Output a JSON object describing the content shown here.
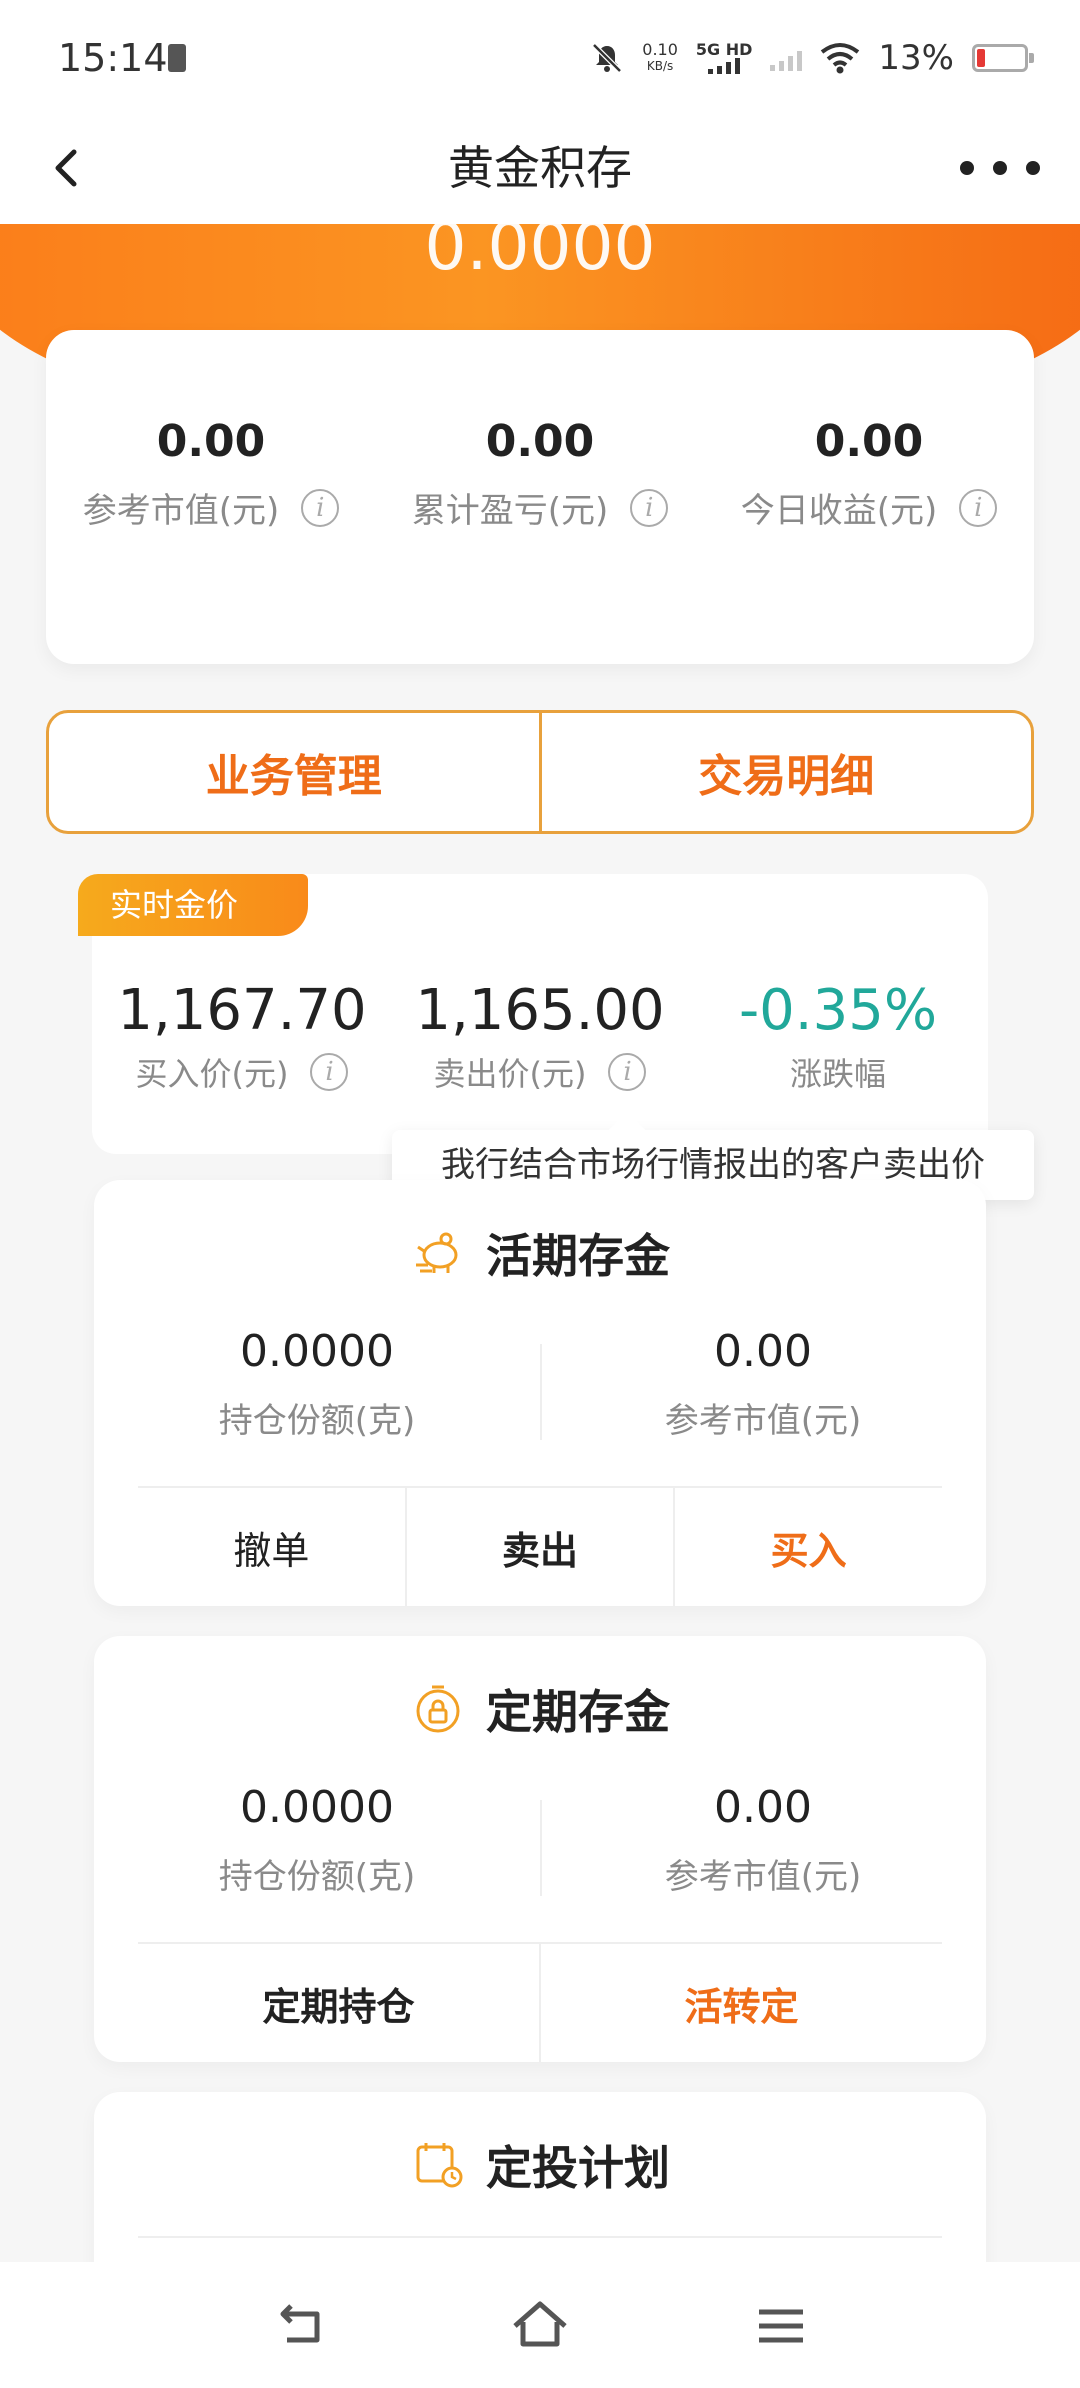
{
  "status_bar": {
    "time": "15:14",
    "net_speed_value": "0.10",
    "net_speed_unit": "KB/s",
    "network_type": "5G HD",
    "battery_percent": "13%"
  },
  "header": {
    "title": "黄金积存"
  },
  "banner": {
    "total_value": "0.0000"
  },
  "summary": {
    "items": [
      {
        "value": "0.00",
        "label": "参考市值(元)"
      },
      {
        "value": "0.00",
        "label": "累计盈亏(元)"
      },
      {
        "value": "0.00",
        "label": "今日收益(元)"
      }
    ]
  },
  "biz_buttons": {
    "manage": "业务管理",
    "details": "交易明细"
  },
  "gold_price": {
    "tag": "实时金价",
    "buy_value": "1,167.70",
    "buy_label": "买入价(元)",
    "sell_value": "1,165.00",
    "sell_label": "卖出价(元)",
    "change_value": "-0.35%",
    "change_label": "涨跌幅",
    "change_color": "#21a89a",
    "tooltip": "我行结合市场行情报出的客户卖出价"
  },
  "demand": {
    "title": "活期存金",
    "holding_value": "0.0000",
    "holding_label": "持仓份额(克)",
    "market_value": "0.00",
    "market_label": "参考市值(元)",
    "actions": [
      "撤单",
      "卖出",
      "买入"
    ]
  },
  "fixed": {
    "title": "定期存金",
    "holding_value": "0.0000",
    "holding_label": "持仓份额(克)",
    "market_value": "0.00",
    "market_label": "参考市值(元)",
    "actions": [
      "定期持仓",
      "活转定"
    ]
  },
  "plan": {
    "title": "定投计划"
  },
  "colors": {
    "accent": "#ef6d18",
    "banner": "#fb8a1e",
    "border": "#e8a13c"
  }
}
